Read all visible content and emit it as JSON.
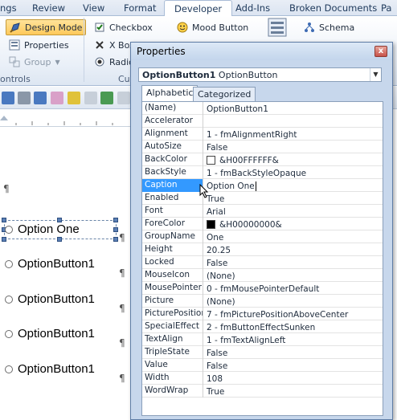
{
  "ribbon": {
    "tabs": [
      "ngs",
      "Review",
      "View",
      "Format",
      "Developer",
      "Add-Ins",
      "Broken Documents",
      "Pa"
    ],
    "controls_group": {
      "design_mode": "Design Mode",
      "properties": "Properties",
      "group": "Group",
      "label": "ontrols"
    },
    "activex": {
      "checkbox": "Checkbox",
      "xbox": "X Box",
      "radio": "Radio",
      "mood_button": "Mood Button",
      "group_label_stub": "Cu"
    },
    "xml": {
      "schema": "Schema"
    }
  },
  "document": {
    "pilcrow": "¶",
    "options": [
      "Option One",
      "OptionButton1",
      "OptionButton1",
      "OptionButton1",
      "OptionButton1"
    ]
  },
  "properties_window": {
    "title": "Properties",
    "close": "x",
    "object_name": "OptionButton1",
    "object_type": "OptionButton",
    "tabs": [
      "Alphabetic",
      "Categorized"
    ],
    "rows": [
      {
        "name": "(Name)",
        "value": "OptionButton1"
      },
      {
        "name": "Accelerator",
        "value": ""
      },
      {
        "name": "Alignment",
        "value": "1 - fmAlignmentRight"
      },
      {
        "name": "AutoSize",
        "value": "False"
      },
      {
        "name": "BackColor",
        "value": "&H00FFFFFF&",
        "swatch": "#ffffff"
      },
      {
        "name": "BackStyle",
        "value": "1 - fmBackStyleOpaque"
      },
      {
        "name": "Caption",
        "value": "Option One"
      },
      {
        "name": "Enabled",
        "value": "True"
      },
      {
        "name": "Font",
        "value": "Arial"
      },
      {
        "name": "ForeColor",
        "value": "&H00000000&",
        "swatch": "#000000"
      },
      {
        "name": "GroupName",
        "value": "One"
      },
      {
        "name": "Height",
        "value": "20.25"
      },
      {
        "name": "Locked",
        "value": "False"
      },
      {
        "name": "MouseIcon",
        "value": "(None)"
      },
      {
        "name": "MousePointer",
        "value": "0 - fmMousePointerDefault"
      },
      {
        "name": "Picture",
        "value": "(None)"
      },
      {
        "name": "PicturePosition",
        "value": "7 - fmPicturePositionAboveCenter"
      },
      {
        "name": "SpecialEffect",
        "value": "2 - fmButtonEffectSunken"
      },
      {
        "name": "TextAlign",
        "value": "1 - fmTextAlignLeft"
      },
      {
        "name": "TripleState",
        "value": "False"
      },
      {
        "name": "Value",
        "value": "False"
      },
      {
        "name": "Width",
        "value": "108"
      },
      {
        "name": "WordWrap",
        "value": "True"
      }
    ],
    "selected_row": "Caption"
  },
  "colors": {
    "selection": "#3399ff",
    "ribbon_pressed": "#ffc95a",
    "window_frame": "#c7d7ec"
  }
}
